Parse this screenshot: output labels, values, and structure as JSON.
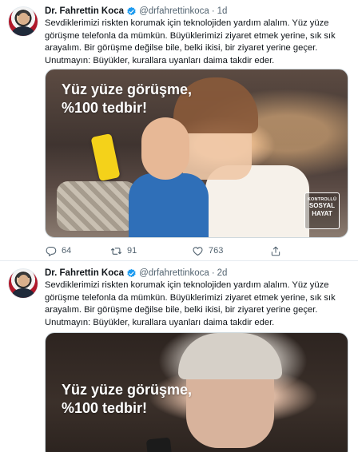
{
  "tweets": [
    {
      "author_name": "Dr. Fahrettin Koca",
      "handle": "@drfahrettinkoca",
      "separator": "·",
      "time": "1d",
      "text_lines": [
        "Sevdiklerimizi riskten korumak için teknolojiden yardım alalım. Yüz yüze",
        "görüşme telefonla da mümkün. Büyüklerimizi ziyaret etmek yerine, sık sık",
        "arayalım. Bir görüşme değilse bile, belki ikisi, bir ziyaret yerine geçer.",
        "Unutmayın: Büyükler, kurallara uyanları daima takdir eder."
      ],
      "media": {
        "caption_line1": "Yüz yüze görüşme,",
        "caption_line2": "%100 tedbir!",
        "badge_line1": "KONTROLLÜ",
        "badge_line2": "SOSYAL",
        "badge_line3": "HAYAT"
      },
      "actions": {
        "reply_count": "64",
        "retweet_count": "91",
        "like_count": "763"
      }
    },
    {
      "author_name": "Dr. Fahrettin Koca",
      "handle": "@drfahrettinkoca",
      "separator": "·",
      "time": "2d",
      "text_lines": [
        "Sevdiklerimizi riskten korumak için teknolojiden yardım alalım. Yüz yüze",
        "görüşme telefonla da mümkün. Büyüklerimizi ziyaret etmek yerine, sık sık",
        "arayalım. Bir görüşme değilse bile, belki ikisi, bir ziyaret yerine geçer.",
        "Unutmayın: Büyükler, kurallara uyanları daima takdir eder."
      ],
      "media": {
        "caption_line1": "Yüz yüze görüşme,",
        "caption_line2": "%100 tedbir!"
      }
    }
  ],
  "icons": {
    "verified": "verified-badge-icon",
    "reply": "reply-icon",
    "retweet": "retweet-icon",
    "like": "heart-icon",
    "share": "share-icon"
  },
  "colors": {
    "verified_blue": "#1d9bf0",
    "secondary_text": "#536471",
    "badge_yellow_phone": "#f4d21a"
  }
}
